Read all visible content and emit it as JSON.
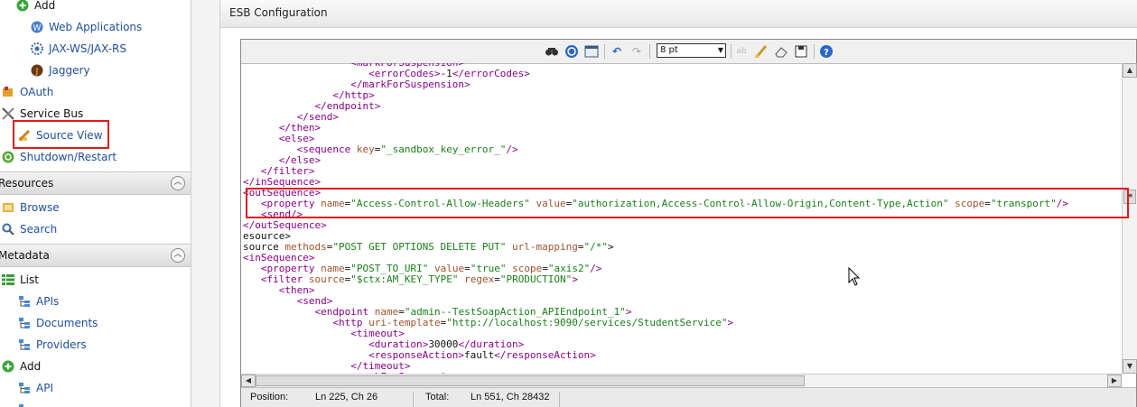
{
  "sidebar": {
    "items": [
      {
        "label": "Add",
        "icon": "plus-circle-icon"
      },
      {
        "label": "Web Applications",
        "icon": "web-app-icon"
      },
      {
        "label": "JAX-WS/JAX-RS",
        "icon": "jax-ws-icon"
      },
      {
        "label": "Jaggery",
        "icon": "jaggery-icon"
      },
      {
        "label": "OAuth",
        "icon": "oauth-icon"
      },
      {
        "label": "Service Bus",
        "icon": "service-bus-icon"
      },
      {
        "label": "Source View",
        "icon": "pencil-icon"
      },
      {
        "label": "Shutdown/Restart",
        "icon": "shutdown-icon"
      }
    ],
    "resources": {
      "title": "Resources",
      "items": [
        {
          "label": "Browse",
          "icon": "browse-icon"
        },
        {
          "label": "Search",
          "icon": "search-icon"
        }
      ]
    },
    "metadata": {
      "title": "Metadata",
      "items": [
        {
          "label": "List",
          "icon": "list-icon"
        },
        {
          "label": "APIs",
          "icon": "tree-icon"
        },
        {
          "label": "Documents",
          "icon": "tree-icon"
        },
        {
          "label": "Providers",
          "icon": "tree-icon"
        },
        {
          "label": "Add",
          "icon": "plus-circle-icon"
        },
        {
          "label": "API",
          "icon": "tree-icon"
        }
      ]
    }
  },
  "panel": {
    "title": "ESB Configuration"
  },
  "editor": {
    "font_size": "8 pt",
    "status": {
      "position_label": "Position:",
      "position_value": "Ln 225, Ch 26",
      "total_label": "Total:",
      "total_value": "Ln 551, Ch 28432"
    }
  },
  "code_lines": [
    "                  <markForSuspension>",
    "                     <errorCodes>-1</errorCodes>",
    "                  </markForSuspension>",
    "               </http>",
    "            </endpoint>",
    "         </send>",
    "      </then>",
    "      <else>",
    "         <sequence key=\"_sandbox_key_error_\"/>",
    "      </else>",
    "   </filter>",
    "</inSequence>",
    "<outSequence>",
    "   <property name=\"Access-Control-Allow-Headers\" value=\"authorization,Access-Control-Allow-Origin,Content-Type,Action\" scope=\"transport\"/>",
    "   <send/>",
    "</outSequence>",
    "esource>",
    "source methods=\"POST GET OPTIONS DELETE PUT\" url-mapping=\"/*\">",
    "<inSequence>",
    "   <property name=\"POST_TO_URI\" value=\"true\" scope=\"axis2\"/>",
    "   <filter source=\"$ctx:AM_KEY_TYPE\" regex=\"PRODUCTION\">",
    "      <then>",
    "         <send>",
    "            <endpoint name=\"admin--TestSoapAction_APIEndpoint_1\">",
    "               <http uri-template=\"http://localhost:9090/services/StudentService\">",
    "                  <timeout>",
    "                     <duration>30000</duration>",
    "                     <responseAction>fault</responseAction>",
    "                  </timeout>",
    "                  <markForSuspension>"
  ],
  "colors": {
    "tag": "#8b008b",
    "attribute": "#a0522d",
    "value": "#1a7f1a",
    "highlight_box": "#e01b1b",
    "link": "#1f4fa0"
  }
}
